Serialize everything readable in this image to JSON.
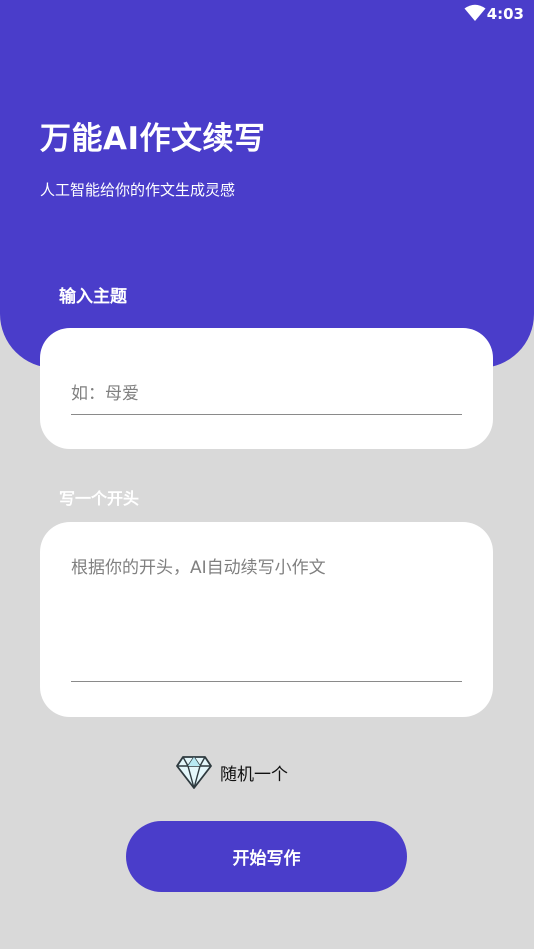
{
  "status_bar": {
    "time": "4:03",
    "wifi_icon": "wifi-icon"
  },
  "header": {
    "title": "万能AI作文续写",
    "subtitle": "人工智能给你的作文生成灵感",
    "background_color": "#4a3dca"
  },
  "topic_section": {
    "label": "输入主题",
    "input_value": "",
    "placeholder": "如：母爱"
  },
  "opening_section": {
    "label": "写一个开头",
    "input_value": "",
    "placeholder": "根据你的开头，AI自动续写小作文"
  },
  "random_option": {
    "icon": "diamond-icon",
    "label": "随机一个"
  },
  "start_button": {
    "label": "开始写作",
    "color": "#4a3dca"
  }
}
